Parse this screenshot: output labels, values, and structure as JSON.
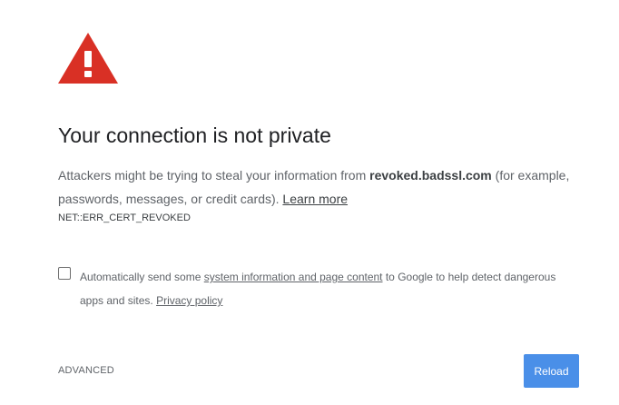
{
  "heading": "Your connection is not private",
  "message": {
    "part1": "Attackers might be trying to steal your information from ",
    "host": "revoked.badssl.com",
    "part2": " (for example, passwords, messages, or credit cards). ",
    "learn_more": "Learn more"
  },
  "error_code": "NET::ERR_CERT_REVOKED",
  "optin": {
    "part1": "Automatically send some ",
    "link1": "system information and page content",
    "part2": " to Google to help detect dangerous apps and sites. ",
    "link2": "Privacy policy",
    "checked": false
  },
  "advanced_label": "ADVANCED",
  "reload_label": "Reload",
  "colors": {
    "warning_red": "#d93025",
    "reload_blue": "#4a8fe8"
  },
  "icons": {
    "warning": "warning-triangle-icon"
  }
}
